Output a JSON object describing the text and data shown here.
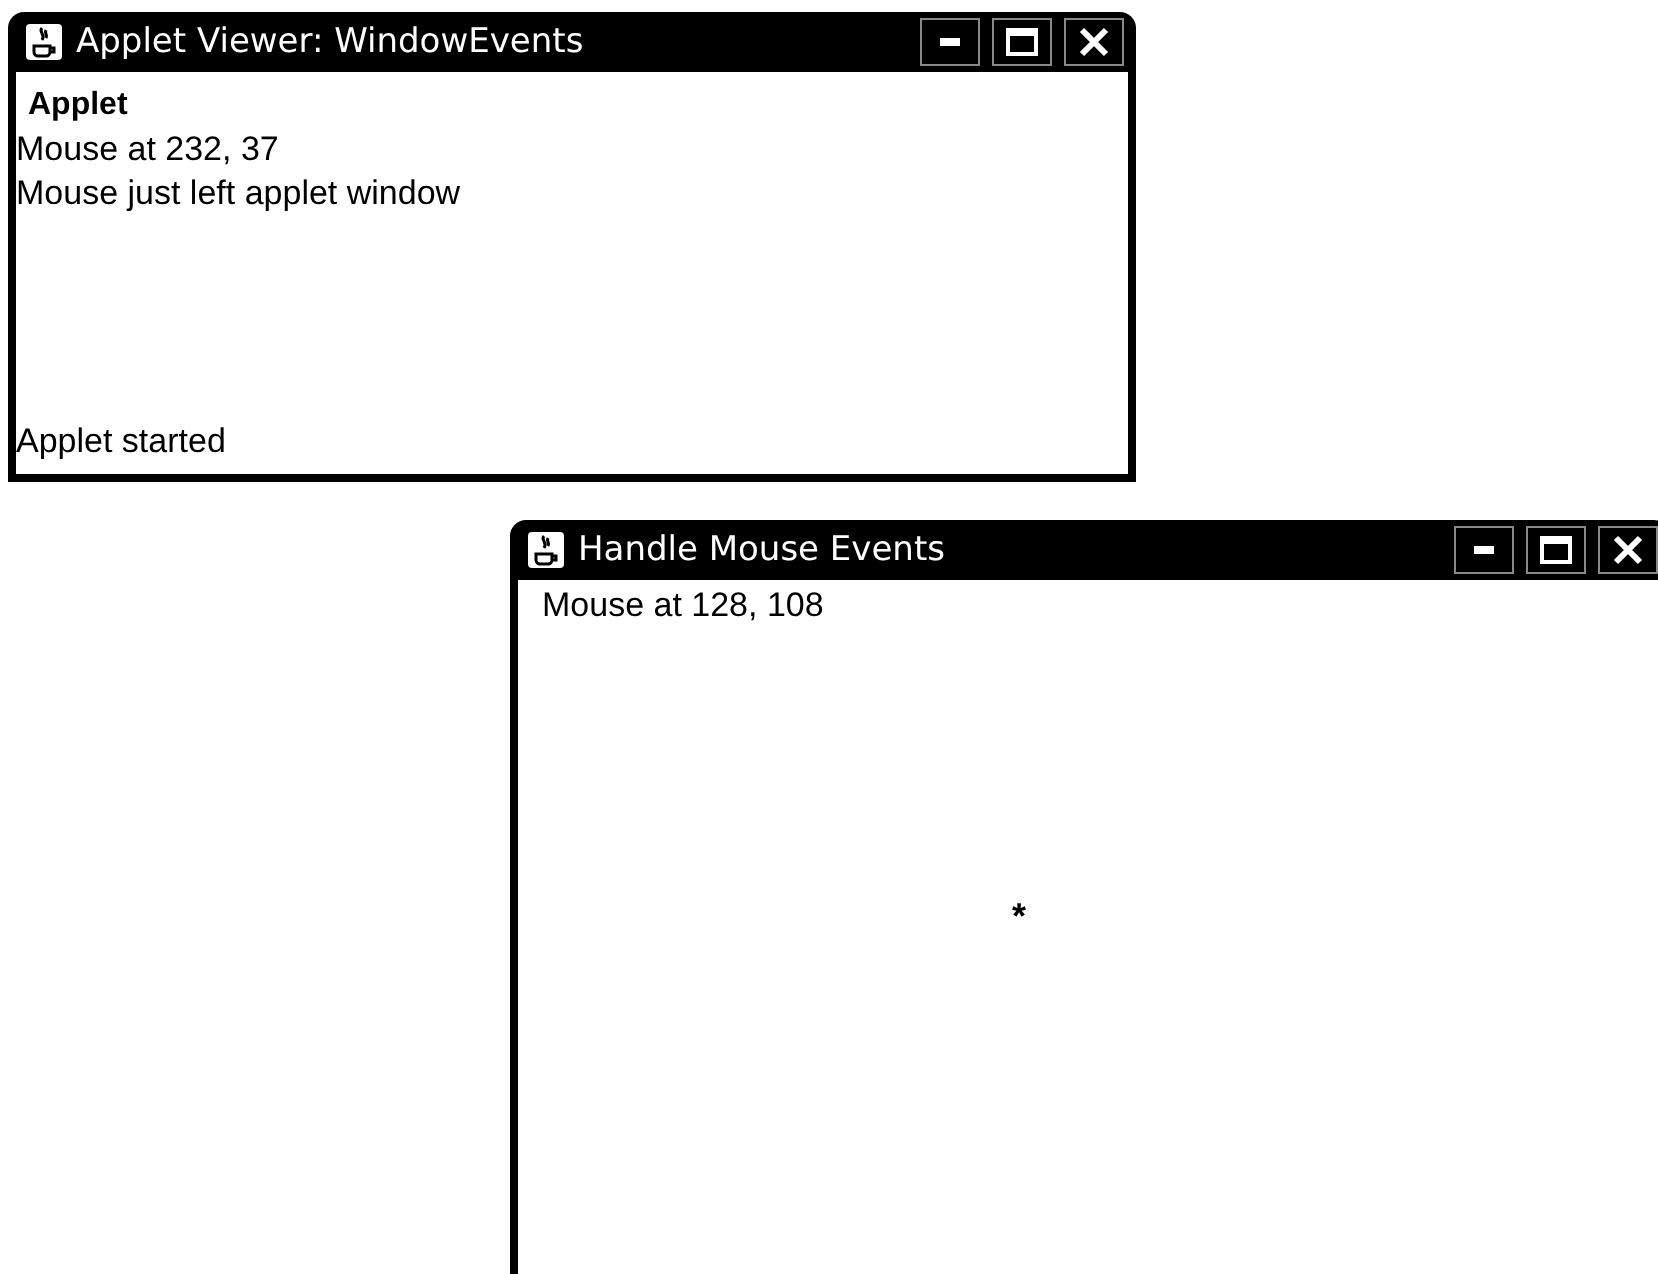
{
  "windows": [
    {
      "title": "Applet Viewer: WindowEvents",
      "kind": "viewer",
      "menu": "Applet",
      "lines": [
        "Mouse at 232, 37",
        "Mouse just left applet window"
      ],
      "status": "Applet started"
    },
    {
      "title": "Handle Mouse Events",
      "kind": "plain",
      "lines": [
        "Mouse at 128, 108"
      ],
      "marker": "*"
    }
  ]
}
